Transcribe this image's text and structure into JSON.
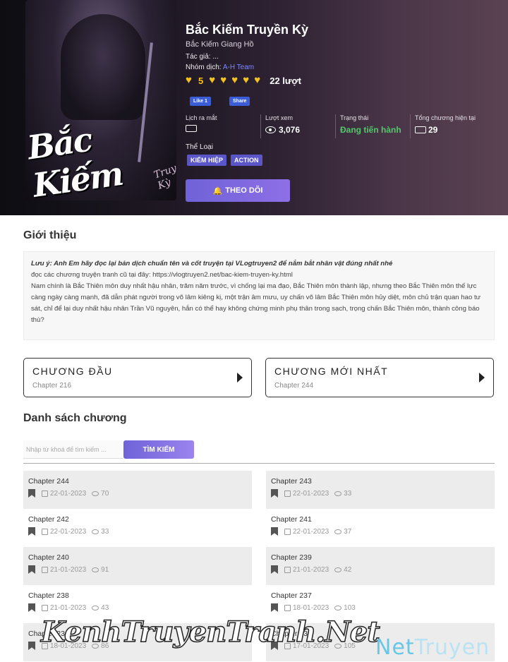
{
  "manga": {
    "title": "Bắc Kiếm Truyền Kỳ",
    "alt_title": "Bắc Kiếm Giang Hồ",
    "author_label": "Tác giả: ...",
    "group_label": "Nhóm dịch:",
    "group_name": "A-H Team",
    "rating_score": "5",
    "rating_votes": "22 lượt",
    "cover_title": "Bắc Kiếm",
    "cover_sub": "Truyền Kỳ"
  },
  "facebook": {
    "like": "Like 1",
    "share": "Share"
  },
  "stats": {
    "release_label": "Lịch ra mắt",
    "views_label": "Lượt xem",
    "views_value": "3,076",
    "status_label": "Trạng thái",
    "status_value": "Đang tiến hành",
    "total_label": "Tổng chương hiện tại",
    "total_value": "29"
  },
  "genres": {
    "label": "Thể Loại",
    "items": [
      "KIẾM HIỆP",
      "ACTION"
    ]
  },
  "follow_button": "THEO DÕI",
  "intro": {
    "heading": "Giới thiệu",
    "note": "Lưu ý: Anh Em hãy đọc lại bản dịch chuẩn tên và cốt truyện tại VLogtruyen2 để nắm bắt nhân vật đúng nhất nhé",
    "old_link": "đọc các chương truyện tranh cũ tại đây: https://vlogtruyen2.net/bac-kiem-truyen-ky.html",
    "body": "Nam chính là Bắc Thiên môn duy nhất hậu nhân, trăm năm trước, vì chống lại ma đạo, Bắc Thiên môn thành lập, nhưng theo Bắc Thiên môn thế lực càng ngày càng mạnh, đã dẫn phát người trong võ lâm kiêng kị, một trận âm mưu, uy chấn võ lâm Bắc Thiên môn hủy diệt, môn chủ trận quan hao tư sát, chỉ để lại duy nhất hậu nhân Trần Vũ nguyên, hắn có thể hay không chứng minh phụ thân trong sạch, trọng chấn Bắc Thiên môn, thành công báo thù?"
  },
  "first_chapter": {
    "label": "CHƯƠNG ĐẦU",
    "chapter": "Chapter 216"
  },
  "latest_chapter": {
    "label": "CHƯƠNG MỚI NHẤT",
    "chapter": "Chapter 244"
  },
  "chapter_list": {
    "heading": "Danh sách chương",
    "search_placeholder": "Nhập từ khoá để tìm kiếm ...",
    "search_button": "TÌM KIẾM",
    "items": [
      {
        "name": "Chapter 244",
        "date": "22-01-2023",
        "views": "70"
      },
      {
        "name": "Chapter 243",
        "date": "22-01-2023",
        "views": "33"
      },
      {
        "name": "Chapter 242",
        "date": "22-01-2023",
        "views": "33"
      },
      {
        "name": "Chapter 241",
        "date": "22-01-2023",
        "views": "37"
      },
      {
        "name": "Chapter 240",
        "date": "21-01-2023",
        "views": "91"
      },
      {
        "name": "Chapter 239",
        "date": "21-01-2023",
        "views": "42"
      },
      {
        "name": "Chapter 238",
        "date": "21-01-2023",
        "views": "43"
      },
      {
        "name": "Chapter 237",
        "date": "18-01-2023",
        "views": "103"
      },
      {
        "name": "Chapter 236",
        "date": "18-01-2023",
        "views": "86"
      },
      {
        "name": "Chapter 235",
        "date": "17-01-2023",
        "views": "105"
      }
    ]
  },
  "watermarks": {
    "script": "KenhTruyenTranh.Net",
    "logo_a": "Net",
    "logo_b": "Truyen"
  },
  "colors": {
    "accent": "#6f62d8",
    "status_green": "#52c86a",
    "rating_gold": "#f7c21a"
  }
}
